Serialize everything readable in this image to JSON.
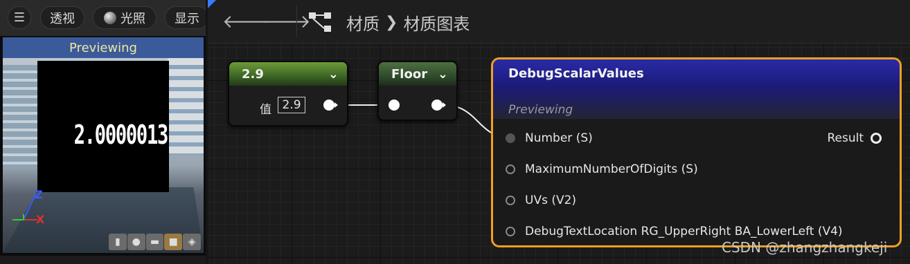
{
  "viewport": {
    "menu_icon": "hamburger-icon",
    "perspective_label": "透视",
    "lighting_label": "光照",
    "show_label": "显示",
    "banner": "Previewing",
    "display_value": "2.0000013",
    "axis": {
      "z": "Z",
      "x": "X"
    },
    "preview_shapes": [
      "cylinder-icon",
      "sphere-icon",
      "plane-icon",
      "cube-icon",
      "mesh-icon"
    ]
  },
  "header": {
    "back_icon": "back-arrow-icon",
    "forward_icon": "forward-arrow-icon",
    "hierarchy_icon": "graph-hierarchy-icon",
    "breadcrumb": [
      "材质",
      "材质图表"
    ]
  },
  "nodes": {
    "constant": {
      "title": "2.9",
      "value_label": "值",
      "value": "2.9"
    },
    "floor": {
      "title": "Floor"
    },
    "debug": {
      "title": "DebugScalarValues",
      "subtitle": "Previewing",
      "inputs": [
        "Number (S)",
        "MaximumNumberOfDigits (S)",
        "UVs (V2)",
        "DebugTextLocation RG_UpperRight BA_LowerLeft (V4)"
      ],
      "output": "Result"
    }
  },
  "watermark": "CSDN @zhangzhangkeji",
  "colors": {
    "selection": "#f0a020",
    "debug_header": "#2a2aa8",
    "constant_header": "#6d9b3a"
  }
}
